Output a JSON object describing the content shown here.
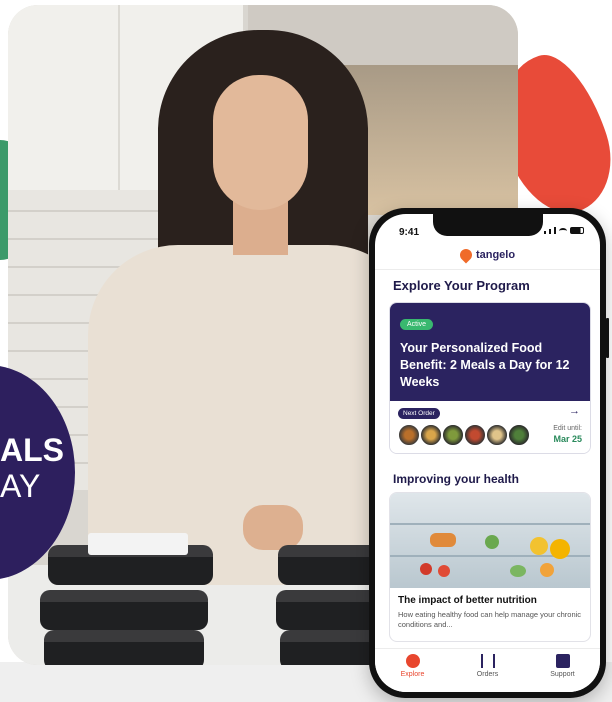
{
  "badge": {
    "line1": "ALS",
    "line2": "AY"
  },
  "phone": {
    "status_time": "9:41",
    "brand": "tangelo",
    "explore_title": "Explore Your Program",
    "program": {
      "status": "Active",
      "headline": "Your Personalized Food Benefit: 2 Meals a Day for 12 Weeks",
      "next_order_label": "Next Order",
      "edit_until_label": "Edit until:",
      "edit_until_date": "Mar 25",
      "meal_count": 6
    },
    "health_title": "Improving your health",
    "article": {
      "title": "The impact of better nutrition",
      "description": "How eating healthy food can help manage your chronic conditions and..."
    },
    "tabs": [
      {
        "label": "Explore",
        "icon": "compass-icon",
        "active": true
      },
      {
        "label": "Orders",
        "icon": "utensils-icon",
        "active": false
      },
      {
        "label": "Support",
        "icon": "chat-icon",
        "active": false
      }
    ]
  },
  "colors": {
    "brand_navy": "#2b2360",
    "accent_orange": "#e8462e",
    "active_green": "#39b86f",
    "date_green": "#2a8a5c"
  }
}
